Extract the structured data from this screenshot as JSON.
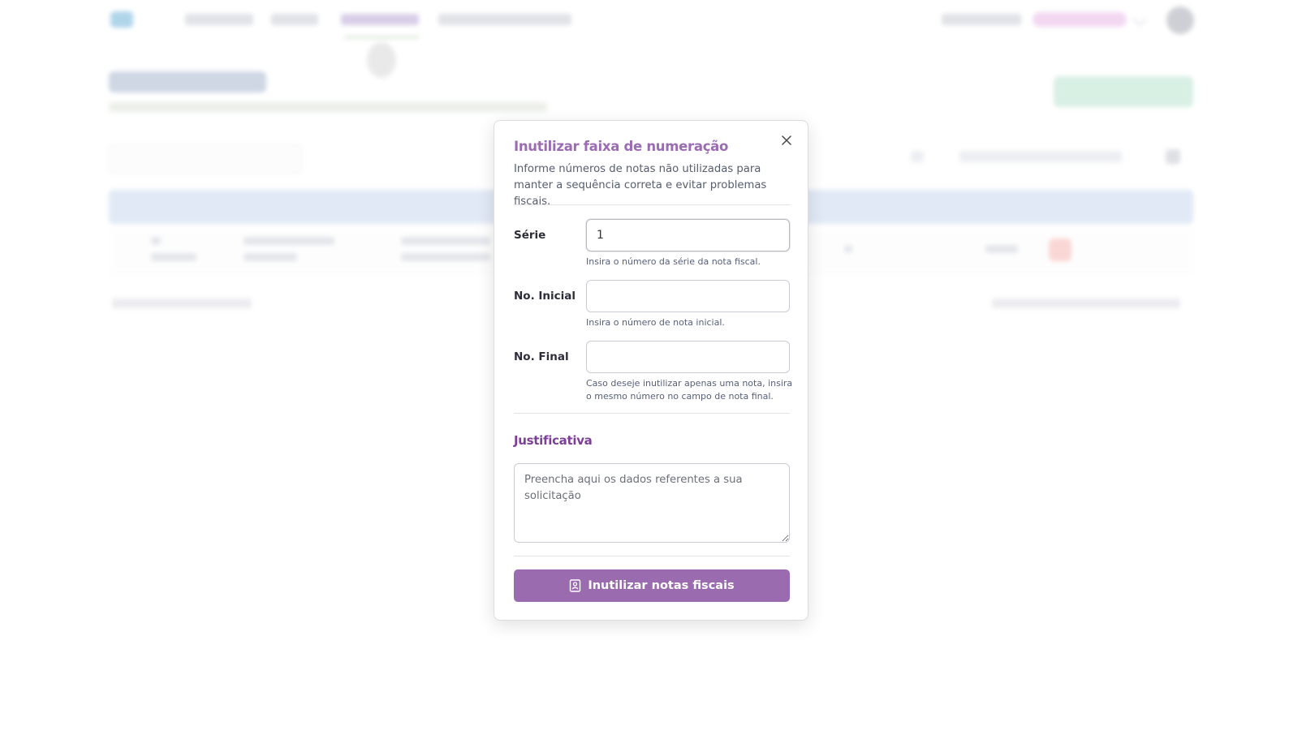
{
  "modal": {
    "title": "Inutilizar faixa de numeração",
    "description": "Informe números de notas não utilizadas para manter a sequência correta e evitar problemas fiscais.",
    "close_icon": "close-icon",
    "fields": {
      "serie": {
        "label": "Série",
        "value": "1",
        "helper": "Insira o número da série da nota fiscal."
      },
      "numero_inicial": {
        "label": "No. Inicial",
        "value": "",
        "helper": "Insira o número de nota inicial."
      },
      "numero_final": {
        "label": "No. Final",
        "value": "",
        "helper": "Caso deseje inutilizar apenas uma nota, insira o mesmo número no campo de nota final."
      }
    },
    "justificativa": {
      "title": "Justificativa",
      "placeholder": "Preencha aqui os dados referentes a sua solicitação",
      "value": ""
    },
    "submit": {
      "label": "Inutilizar notas fiscais",
      "icon": "document-icon"
    }
  },
  "colors": {
    "title": "#9b6bb3",
    "section_title": "#7e3f99",
    "button": "#9b6bb0"
  }
}
